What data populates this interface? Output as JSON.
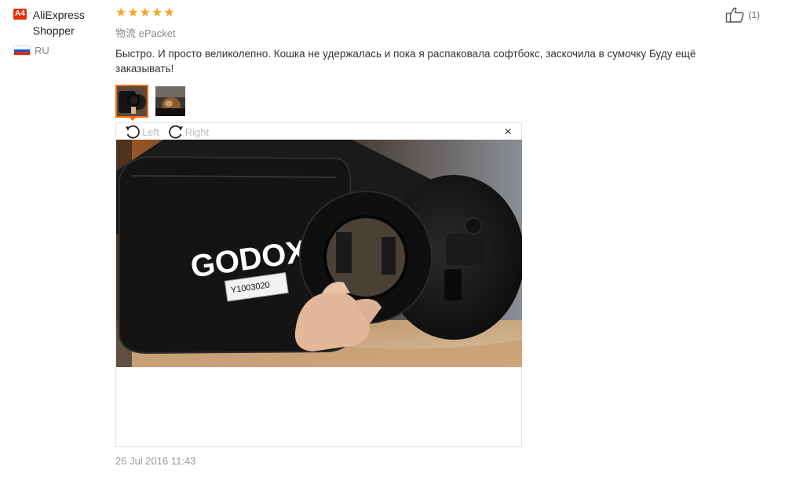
{
  "user": {
    "level_badge": "A4",
    "name": "AliExpress Shopper",
    "country_code": "RU",
    "flag_colors": [
      "#ffffff",
      "#1c57c2",
      "#d52b1e"
    ]
  },
  "review": {
    "rating": 5,
    "stars": [
      "★",
      "★",
      "★",
      "★",
      "★"
    ],
    "logistics_label": "物流",
    "logistics_value": "ePacket",
    "text": "Быстро. И просто великолепно. Кошка не удержалась и пока я распаковала софтбокс, заскочила в сумочку Буду ещё заказывать!",
    "date": "26 Jul 2016 11:43"
  },
  "viewer": {
    "rotate_left_label": "Left",
    "rotate_right_label": "Right",
    "close_glyph": "×",
    "photo_brand_text": "GODOX",
    "photo_tag_text": "Y1003020"
  },
  "helpful": {
    "count": "(1)"
  },
  "colors": {
    "accent": "#ff6a00",
    "star": "#f5a623",
    "badge": "#e62e04"
  }
}
